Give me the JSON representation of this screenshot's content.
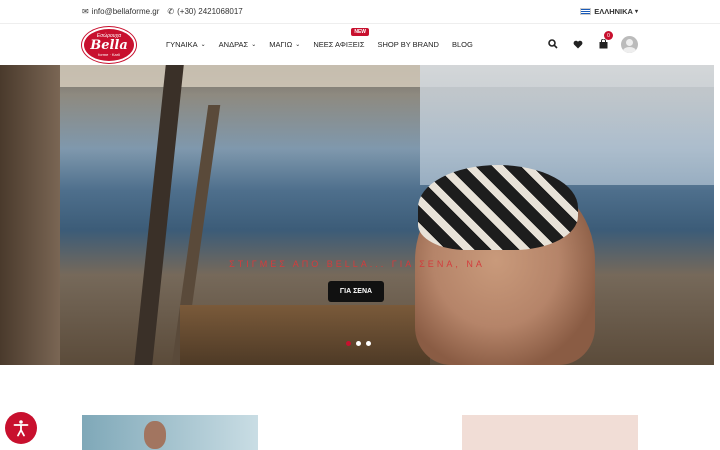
{
  "topbar": {
    "email": "info@bellaforme.gr",
    "phone": "(+30) 2421068017",
    "language": "ΕΛΛΗΝΙΚΑ"
  },
  "logo": {
    "top": "Εσώρουχα",
    "brand": "Bella",
    "sub": "forme · Karli"
  },
  "nav": {
    "items": [
      {
        "label": "ΓΥΝΑΙΚΑ",
        "has_dropdown": true
      },
      {
        "label": "ΑΝΔΡΑΣ",
        "has_dropdown": true
      },
      {
        "label": "ΜΑΓΙΩ",
        "has_dropdown": true
      },
      {
        "label": "ΝΕΕΣ ΑΦΙΞΕΙΣ",
        "has_dropdown": false
      },
      {
        "label": "SHOP BY BRAND",
        "has_dropdown": false
      },
      {
        "label": "BLOG",
        "has_dropdown": false
      }
    ],
    "new_badge": "NEW"
  },
  "header_icons": {
    "search": "search-icon",
    "wishlist": "heart-icon",
    "cart": "bag-icon",
    "cart_count": "0",
    "account": "user-avatar"
  },
  "hero": {
    "title": "ΣΤΙΓΜΕΣ ΑΠΟ BELLA... ΓΙΑ ΣΕΝΑ, ΝΑ",
    "button": "ΓΙΑ ΣΕΝΑ",
    "slides": 3,
    "active_slide": 1
  },
  "colors": {
    "brand_red": "#c8102e",
    "text_dark": "#222222"
  }
}
